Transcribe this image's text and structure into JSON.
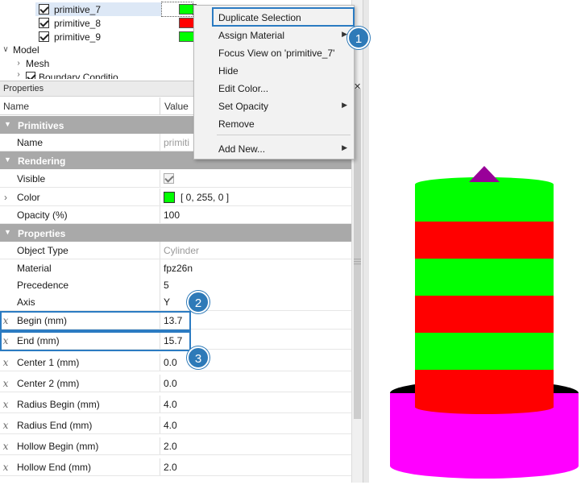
{
  "tree": {
    "items": [
      {
        "label": "primitive_7",
        "checked": true,
        "color": "#00ff00"
      },
      {
        "label": "primitive_8",
        "checked": true,
        "color": "#ff0000"
      },
      {
        "label": "primitive_9",
        "checked": true,
        "color": "#00ff00"
      }
    ],
    "model_label": "Model",
    "mesh_label": "Mesh",
    "partial_label": "Boundary Conditio..."
  },
  "properties": {
    "panel_title": "Properties",
    "col_name": "Name",
    "col_value": "Value",
    "categories": {
      "primitives": "Primitives",
      "rendering": "Rendering",
      "properties": "Properties"
    },
    "rows": {
      "name": {
        "label": "Name",
        "value": "primiti"
      },
      "visible": {
        "label": "Visible"
      },
      "color": {
        "label": "Color",
        "value": "[ 0, 255, 0 ]",
        "swatch": "#00ff00"
      },
      "opacity": {
        "label": "Opacity (%)",
        "value": "100"
      },
      "object_type": {
        "label": "Object Type",
        "value": "Cylinder"
      },
      "material": {
        "label": "Material",
        "value": "fpz26n"
      },
      "precedence": {
        "label": "Precedence",
        "value": "5"
      },
      "axis": {
        "label": "Axis",
        "value": "Y"
      },
      "begin": {
        "label": "Begin (mm)",
        "value": "13.7"
      },
      "end": {
        "label": "End (mm)",
        "value": "15.7"
      },
      "center1": {
        "label": "Center 1 (mm)",
        "value": "0.0"
      },
      "center2": {
        "label": "Center 2 (mm)",
        "value": "0.0"
      },
      "radius_begin": {
        "label": "Radius Begin (mm)",
        "value": "4.0"
      },
      "radius_end": {
        "label": "Radius End (mm)",
        "value": "4.0"
      },
      "hollow_begin": {
        "label": "Hollow Begin (mm)",
        "value": "2.0"
      },
      "hollow_end": {
        "label": "Hollow End (mm)",
        "value": "2.0"
      }
    },
    "param_glyph": "x"
  },
  "context_menu": {
    "items": [
      {
        "label": "Duplicate Selection"
      },
      {
        "label": "Assign Material",
        "submenu": true
      },
      {
        "label": "Focus View on 'primitive_7'"
      },
      {
        "label": "Hide"
      },
      {
        "label": "Edit Color..."
      },
      {
        "label": "Set Opacity",
        "submenu": true
      },
      {
        "label": "Remove"
      },
      {
        "label": "Add New...",
        "submenu": true
      }
    ]
  },
  "callouts": {
    "one": "1",
    "two": "2",
    "three": "3"
  },
  "viewport": {
    "stripe_colors": [
      "#00ff00",
      "#ff0000",
      "#00ff00",
      "#ff0000",
      "#00ff00",
      "#ff0000"
    ],
    "base_color": "#ff00ff",
    "tip_color": "#990099"
  },
  "colors": {
    "accent": "#2b7bc2",
    "category_bg": "#a9a9a9"
  }
}
